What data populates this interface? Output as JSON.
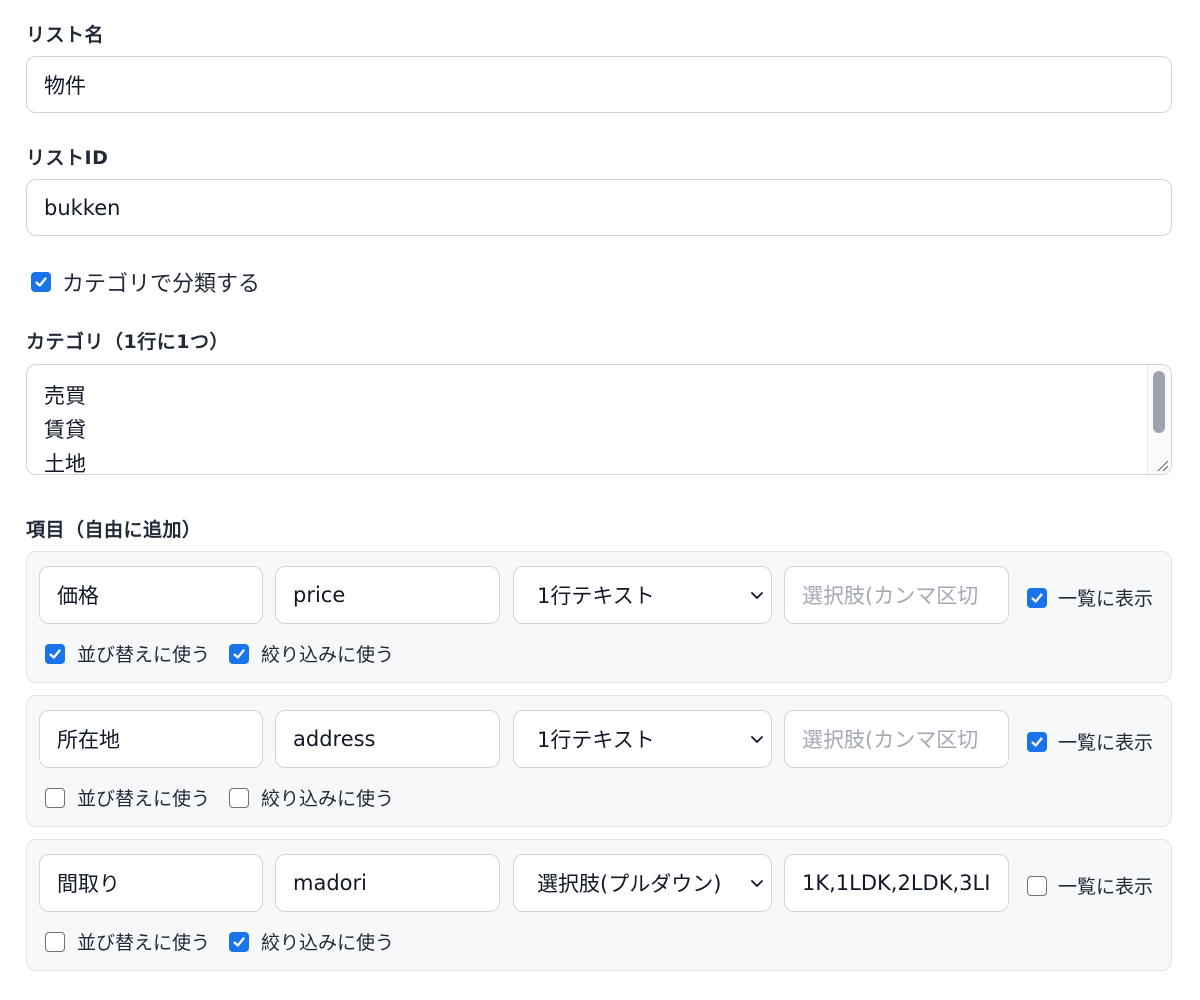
{
  "list_name": {
    "label": "リスト名",
    "value": "物件"
  },
  "list_id": {
    "label": "リストID",
    "value": "bukken"
  },
  "categorize": {
    "label": "カテゴリで分類する",
    "checked": true
  },
  "categories": {
    "label": "カテゴリ（1行に1つ）",
    "lines": [
      "売買",
      "賃貸",
      "土地"
    ]
  },
  "items_section": {
    "label": "項目（自由に追加）"
  },
  "items": [
    {
      "name": "価格",
      "id": "price",
      "type": "1行テキスト",
      "options_value": "",
      "options_placeholder": "選択肢(カンマ区切",
      "show_in_list_label": "一覧に表示",
      "show_in_list": true,
      "sort_label": "並び替えに使う",
      "sort": true,
      "filter_label": "絞り込みに使う",
      "filter": true
    },
    {
      "name": "所在地",
      "id": "address",
      "type": "1行テキスト",
      "options_value": "",
      "options_placeholder": "選択肢(カンマ区切",
      "show_in_list_label": "一覧に表示",
      "show_in_list": true,
      "sort_label": "並び替えに使う",
      "sort": false,
      "filter_label": "絞り込みに使う",
      "filter": false
    },
    {
      "name": "間取り",
      "id": "madori",
      "type": "選択肢(プルダウン)",
      "options_value": "1K,1LDK,2LDK,3LI",
      "options_placeholder": "",
      "show_in_list_label": "一覧に表示",
      "show_in_list": false,
      "sort_label": "並び替えに使う",
      "sort": false,
      "filter_label": "絞り込みに使う",
      "filter": true
    }
  ],
  "colors": {
    "accent": "#1a73e8",
    "border": "#cdd5df",
    "card_bg": "#f6f8fa",
    "placeholder": "#a3aab5"
  }
}
